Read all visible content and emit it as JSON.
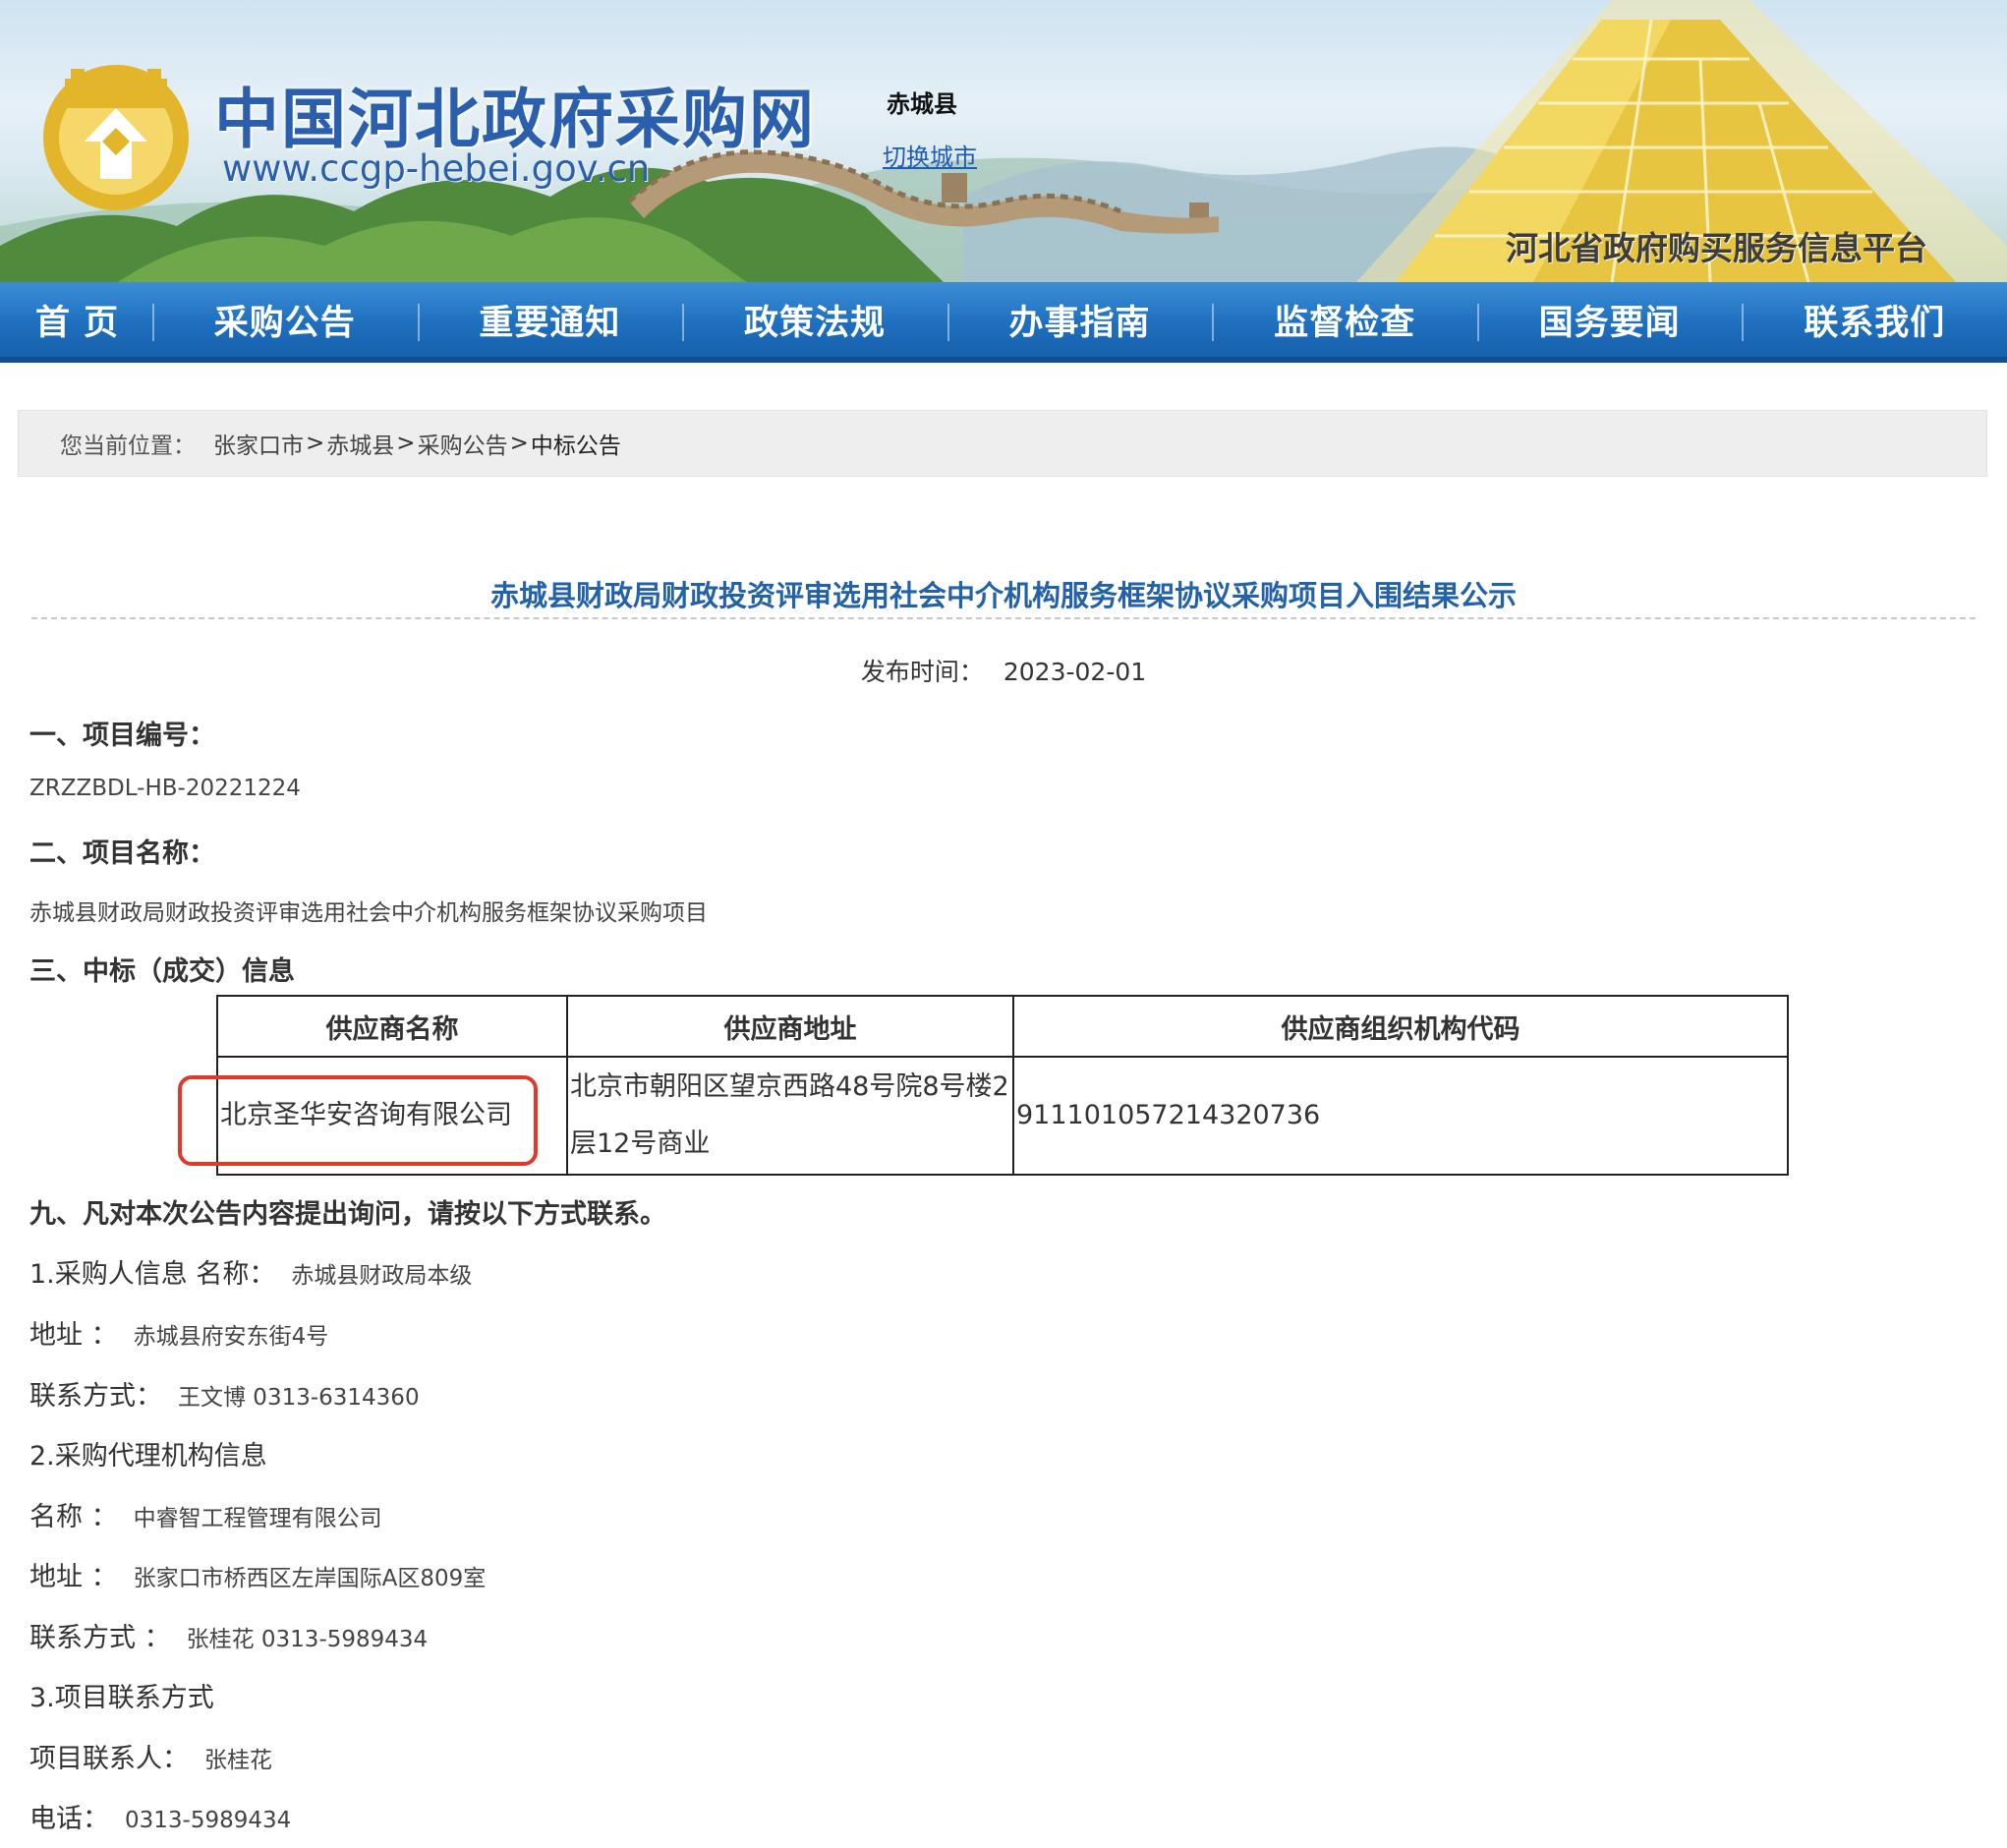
{
  "header": {
    "site_title": "中国河北政府采购网",
    "site_url": "www.ccgp-hebei.gov.cn",
    "city_name": "赤城县",
    "switch_city": "切换城市",
    "platform_title": "河北省政府购买服务信息平台"
  },
  "nav": {
    "items": [
      "首 页",
      "采购公告",
      "重要通知",
      "政策法规",
      "办事指南",
      "监督检查",
      "国务要闻",
      "联系我们"
    ]
  },
  "breadcrumb": {
    "label": "您当前位置：",
    "items": [
      "张家口市",
      "赤城县",
      "采购公告",
      "中标公告"
    ],
    "separator": ">"
  },
  "article": {
    "title": "赤城县财政局财政投资评审选用社会中介机构服务框架协议采购项目入围结果公示",
    "publish_label": "发布时间：",
    "publish_date": "2023-02-01",
    "section1_title": "一、项目编号：",
    "project_number": "ZRZZBDL-HB-20221224",
    "section2_title": "二、项目名称：",
    "project_name": "赤城县财政局财政投资评审选用社会中介机构服务框架协议采购项目",
    "section3_title": "三、中标（成交）信息",
    "table": {
      "headers": [
        "供应商名称",
        "供应商地址",
        "供应商组织机构代码"
      ],
      "rows": [
        {
          "name": "北京圣华安咨询有限公司",
          "address": "北京市朝阳区望京西路48号院8号楼2层12号商业",
          "code": "911101057214320736"
        }
      ]
    },
    "section9_title": "九、凡对本次公告内容提出询问，请按以下方式联系。",
    "purchaser": {
      "heading": "1.采购人信息 名称：",
      "name": "赤城县财政局本级",
      "address_label": "地址 ：",
      "address": "赤城县府安东街4号",
      "contact_label": "联系方式：",
      "contact": "王文博 0313-6314360"
    },
    "agency": {
      "heading": "2.采购代理机构信息",
      "name_label": "名称 ：",
      "name": "中睿智工程管理有限公司",
      "address_label": "地址 ：",
      "address": "张家口市桥西区左岸国际A区809室",
      "contact_label": "联系方式 ：",
      "contact": "张桂花 0313-5989434"
    },
    "project_contact": {
      "heading": "3.项目联系方式",
      "person_label": "项目联系人：",
      "person": "张桂花",
      "phone_label": "电话：",
      "phone": "0313-5989434"
    }
  },
  "colors": {
    "nav_blue": "#1f6fbf",
    "title_blue": "#2362a8",
    "highlight_red": "#e0392b",
    "logo_gold": "#d9a91c"
  },
  "icons": [
    "logo-emblem-icon",
    "great-wall-scene",
    "gold-pyramid-scene"
  ]
}
